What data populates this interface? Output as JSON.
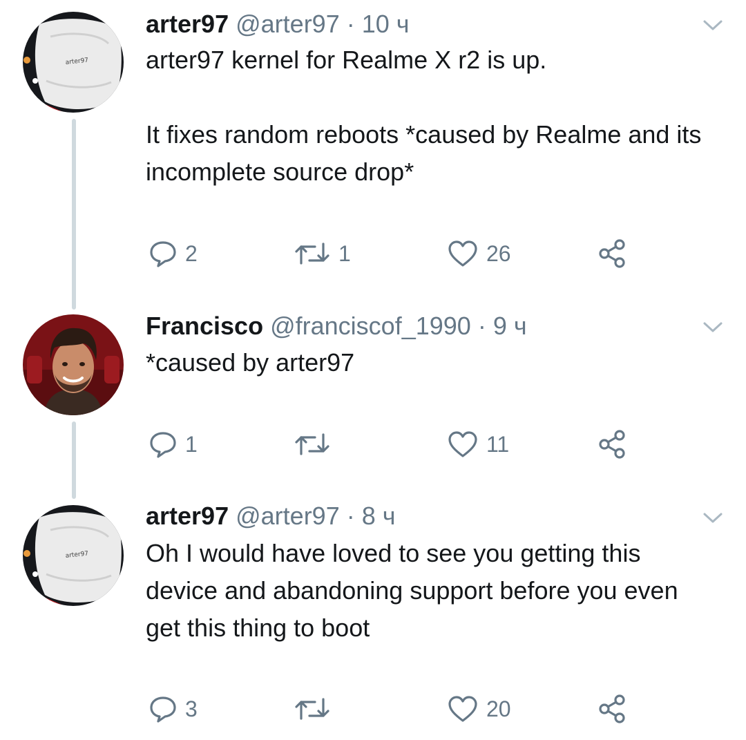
{
  "colors": {
    "text": "#14171a",
    "secondary": "#657786",
    "thread_line": "#cfd9de"
  },
  "tweets": [
    {
      "display_name": "arter97",
      "handle": "@arter97",
      "separator": "·",
      "timestamp": "10 ч",
      "text": "arter97 kernel for Realme X r2 is up.\n\nIt fixes random reboots *caused by Realme and its incomplete source drop*",
      "reply_count": "2",
      "retweet_count": "1",
      "like_count": "26",
      "avatar": "pillow-avatar"
    },
    {
      "display_name": "Francisco",
      "handle": "@franciscof_1990",
      "separator": "·",
      "timestamp": "9 ч",
      "text": "*caused by arter97",
      "reply_count": "1",
      "retweet_count": "",
      "like_count": "11",
      "avatar": "smiling-man-avatar"
    },
    {
      "display_name": "arter97",
      "handle": "@arter97",
      "separator": "·",
      "timestamp": "8 ч",
      "text": "Oh I would have loved to see you getting this device and abandoning support before you even get this thing to boot",
      "reply_count": "3",
      "retweet_count": "",
      "like_count": "20",
      "avatar": "pillow-avatar"
    }
  ]
}
